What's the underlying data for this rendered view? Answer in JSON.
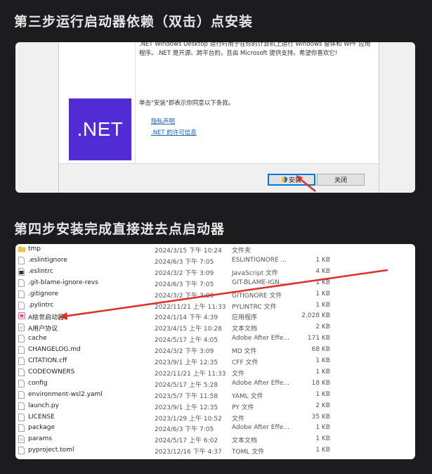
{
  "headings": {
    "step3": "第三步运行启动器依赖（双击）点安装",
    "step4": "第四步安装完成直接进去点启动器"
  },
  "installer": {
    "logo_text": ".NET",
    "description": ".NET Windows Desktop 运行时用于在你的计算机上运行 Windows 窗体和 WPF 应用程序。.NET 是开源、跨平台的，且由 Microsoft 提供支持。希望你喜欢它!",
    "consent": "单击\"安装\"即表示你同意以下条款。",
    "link_privacy": "隐私声明",
    "link_license": ".NET 的许可信息",
    "install_button": "安装",
    "close_button": "关闭",
    "accent": "#512bd4"
  },
  "files": [
    {
      "name": "tmp",
      "date": "2024/3/15 下午 10:24",
      "type": "文件夹",
      "size": "",
      "icon": "folder-icon"
    },
    {
      "name": ".eslintignore",
      "date": "2024/6/3 下午 7:05",
      "type": "ESLINTIGNORE ...",
      "size": "1 KB",
      "icon": "file-icon"
    },
    {
      "name": ".eslintrc",
      "date": "2024/3/2 下午 3:09",
      "type": "JavaScript 文件",
      "size": "4 KB",
      "icon": "script-file-icon"
    },
    {
      "name": ".git-blame-ignore-revs",
      "date": "2024/6/3 下午 7:05",
      "type": "GIT-BLAME-IGN...",
      "size": "1 KB",
      "icon": "file-icon"
    },
    {
      "name": ".gitignore",
      "date": "2024/3/2 下午 3:09",
      "type": "GITIGNORE 文件",
      "size": "1 KB",
      "icon": "file-icon"
    },
    {
      "name": ".pylintrc",
      "date": "2022/11/21 上午 11:33",
      "type": "PYLINTRC 文件",
      "size": "1 KB",
      "icon": "file-icon"
    },
    {
      "name": "A绘世启动器",
      "date": "2024/1/14 下午 4:39",
      "type": "应用程序",
      "size": "2,028 KB",
      "icon": "app-icon"
    },
    {
      "name": "A用户协议",
      "date": "2023/4/15 上午 10:28",
      "type": "文本文档",
      "size": "2 KB",
      "icon": "text-file-icon"
    },
    {
      "name": "cache",
      "date": "2024/5/17 上午 4:05",
      "type": "Adobe After Effe...",
      "size": "171 KB",
      "icon": "file-icon"
    },
    {
      "name": "CHANGELOG.md",
      "date": "2024/3/2 下午 3:09",
      "type": "MD 文件",
      "size": "68 KB",
      "icon": "file-icon"
    },
    {
      "name": "CITATION.cff",
      "date": "2023/9/1 上午 12:35",
      "type": "CFF 文件",
      "size": "1 KB",
      "icon": "file-icon"
    },
    {
      "name": "CODEOWNERS",
      "date": "2022/11/21 上午 11:33",
      "type": "文件",
      "size": "1 KB",
      "icon": "file-icon"
    },
    {
      "name": "config",
      "date": "2024/5/17 上午 5:28",
      "type": "Adobe After Effe...",
      "size": "18 KB",
      "icon": "file-icon"
    },
    {
      "name": "environment-wsl2.yaml",
      "date": "2023/5/7 下午 11:58",
      "type": "YAML 文件",
      "size": "1 KB",
      "icon": "file-icon"
    },
    {
      "name": "launch.py",
      "date": "2023/9/1 上午 12:35",
      "type": "PY 文件",
      "size": "2 KB",
      "icon": "file-icon"
    },
    {
      "name": "LICENSE",
      "date": "2023/1/29 上午 10:52",
      "type": "文件",
      "size": "35 KB",
      "icon": "file-icon"
    },
    {
      "name": "package",
      "date": "2024/6/3 下午 7:05",
      "type": "Adobe After Effe...",
      "size": "1 KB",
      "icon": "file-icon"
    },
    {
      "name": "params",
      "date": "2024/5/17 上午 6:02",
      "type": "文本文档",
      "size": "1 KB",
      "icon": "text-file-icon"
    },
    {
      "name": "pyproject.toml",
      "date": "2023/12/16 下午 4:37",
      "type": "TOML 文件",
      "size": "1 KB",
      "icon": "file-icon"
    }
  ]
}
